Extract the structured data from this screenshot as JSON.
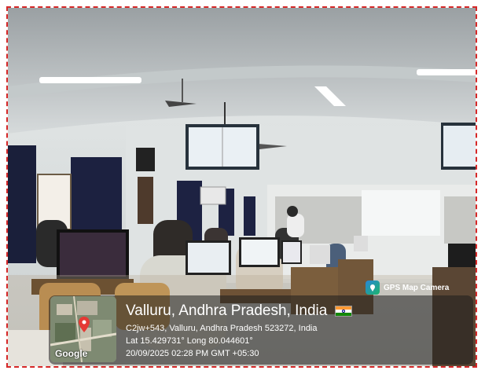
{
  "gps_badge": {
    "label": "GPS Map Camera",
    "icon": "gps-map-camera-icon"
  },
  "location": {
    "title": "Valluru, Andhra Pradesh, India",
    "address": "C2jw+543, Valluru, Andhra Pradesh 523272, India",
    "coordinates": "Lat 15.429731° Long 80.044601°",
    "datetime": "20/09/2025 02:28 PM GMT +05:30"
  },
  "map": {
    "brand": "Google",
    "pin_color": "#e53935"
  },
  "colors": {
    "border": "#d62828",
    "flag_saffron": "#ff9933",
    "flag_green": "#138808"
  }
}
